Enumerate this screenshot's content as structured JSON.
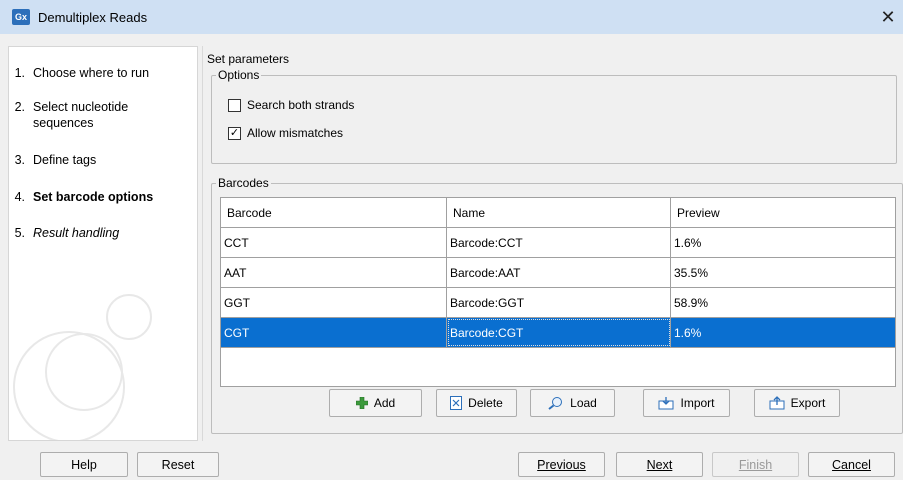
{
  "window": {
    "title": "Demultiplex Reads",
    "app_icon_text": "Gx"
  },
  "steps": [
    {
      "num": "1.",
      "label": "Choose where to run"
    },
    {
      "num": "2.",
      "label": "Select nucleotide sequences"
    },
    {
      "num": "3.",
      "label": "Define tags"
    },
    {
      "num": "4.",
      "label": "Set barcode options"
    },
    {
      "num": "5.",
      "label": "Result handling"
    }
  ],
  "main": {
    "title": "Set parameters",
    "options": {
      "legend": "Options",
      "search_both_strands": {
        "label": "Search both strands",
        "checked": false
      },
      "allow_mismatches": {
        "label": "Allow mismatches",
        "checked": true
      }
    },
    "barcodes": {
      "legend": "Barcodes",
      "columns": [
        "Barcode",
        "Name",
        "Preview"
      ],
      "rows": [
        {
          "barcode": "CCT",
          "name": "Barcode:CCT",
          "preview": "1.6%"
        },
        {
          "barcode": "AAT",
          "name": "Barcode:AAT",
          "preview": "35.5%"
        },
        {
          "barcode": "GGT",
          "name": "Barcode:GGT",
          "preview": "58.9%"
        },
        {
          "barcode": "CGT",
          "name": "Barcode:CGT",
          "preview": "1.6%"
        }
      ],
      "selected_row": "CGT",
      "buttons": {
        "add": "Add",
        "delete": "Delete",
        "load": "Load",
        "import": "Import",
        "export": "Export"
      }
    }
  },
  "footer": {
    "help": "Help",
    "reset": "Reset",
    "previous": "Previous",
    "next": "Next",
    "finish": "Finish",
    "cancel": "Cancel"
  },
  "colors": {
    "titlebar": "#cfe0f3",
    "selection": "#0a6fd0",
    "add_icon": "#3c9a3c"
  }
}
